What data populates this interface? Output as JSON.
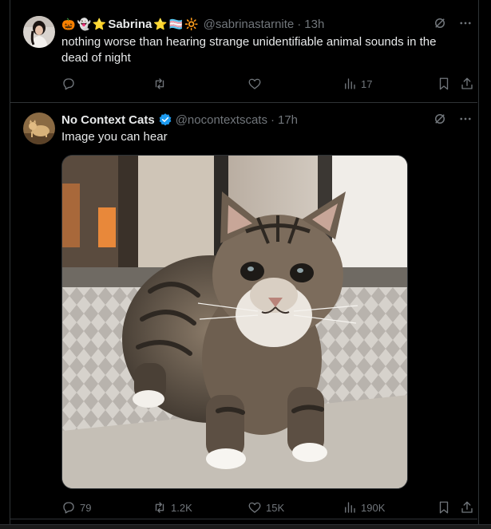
{
  "tweets": [
    {
      "emojis": [
        "🎃",
        "👻",
        "⭐"
      ],
      "name": "Sabrina",
      "name_suffix": [
        "⭐",
        "🏳️‍⚧️",
        "🔆"
      ],
      "handle": "@sabrinastarnite",
      "time": "13h",
      "text": "nothing worse than hearing strange unidentifiable animal sounds in the dead of night",
      "stats": {
        "replies": "",
        "reposts": "",
        "likes": "",
        "views": "17"
      }
    },
    {
      "name": "No Context Cats",
      "verified": true,
      "handle": "@nocontextscats",
      "time": "17h",
      "text": "Image you can hear",
      "stats": {
        "replies": "79",
        "reposts": "1.2K",
        "likes": "15K",
        "views": "190K"
      }
    }
  ],
  "colors": {
    "background": "#000000",
    "text": "#e7e9ea",
    "muted": "#71767b",
    "divider": "#2f3336",
    "verified": "#1d9bf0"
  },
  "icons": [
    "reply-icon",
    "repost-icon",
    "like-icon",
    "views-icon",
    "bookmark-icon",
    "share-icon",
    "grok-icon",
    "more-icon",
    "verified-icon"
  ]
}
